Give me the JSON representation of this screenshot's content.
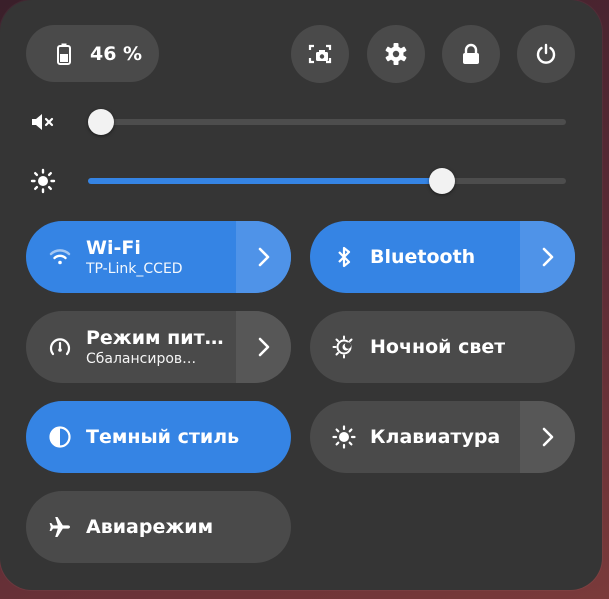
{
  "battery": {
    "label": "46 %",
    "level": 46
  },
  "header_buttons": [
    {
      "name": "screenshot-button",
      "icon": "screenshot-icon"
    },
    {
      "name": "settings-button",
      "icon": "gear-icon"
    },
    {
      "name": "lock-button",
      "icon": "lock-icon"
    },
    {
      "name": "power-button",
      "icon": "power-icon"
    }
  ],
  "volume": {
    "icon": "speaker-muted-icon",
    "level": 0
  },
  "brightness": {
    "icon": "brightness-icon",
    "level": 0.74
  },
  "tiles": {
    "wifi": {
      "title": "Wi-Fi",
      "subtitle": "TP-Link_CCED",
      "active": true
    },
    "bluetooth": {
      "title": "Bluetooth",
      "active": true
    },
    "power_mode": {
      "title": "Режим пит…",
      "subtitle": "Сбалансиров…",
      "active": false
    },
    "night_light": {
      "title": "Ночной свет",
      "active": false
    },
    "dark_style": {
      "title": "Темный стиль",
      "active": true
    },
    "keyboard": {
      "title": "Клавиатура",
      "active": false
    },
    "airplane": {
      "title": "Авиарежим",
      "active": false
    }
  },
  "colors": {
    "accent": "#3584e4",
    "panel": "#353535",
    "button": "#4a4a4a"
  }
}
